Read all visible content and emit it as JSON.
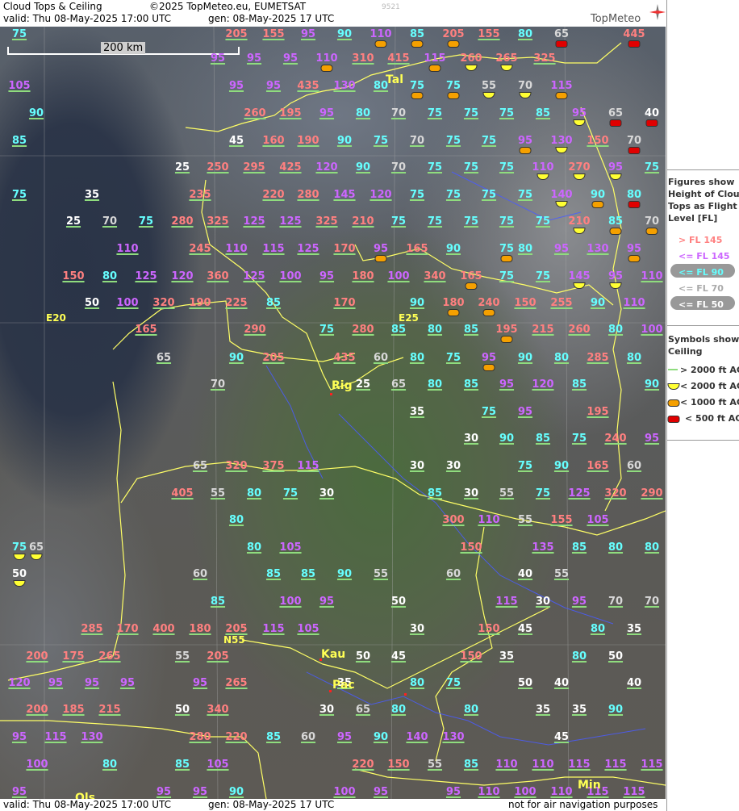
{
  "header": {
    "title": "Cloud Tops & Ceiling",
    "copyright": "©2025 TopMeteo.eu, EUMETSAT",
    "code": "9521",
    "valid": "valid:  Thu  08-May-2025  17:00 UTC",
    "gen": "gen: 08-May-2025 17 UTC",
    "brand": "TopMeteo"
  },
  "footer": {
    "valid": "valid:  Thu  08-May-2025  17:00 UTC",
    "gen": "gen: 08-May-2025 17 UTC",
    "note": "not for air navigation purposes"
  },
  "scale": {
    "label": "200 km"
  },
  "colors": {
    "red": "#ff8080",
    "magenta": "#cc66ff",
    "cyan": "#66ffff",
    "white": "#ffffff",
    "gray": "#d8d8d8",
    "yellow": "#ffff55"
  },
  "legend": {
    "tops_title": [
      "Figures show",
      "Height of Cloud",
      "Tops as Flight",
      "Level  [FL]"
    ],
    "tops_items": [
      {
        "label": "> FL 145",
        "color": "#ff8080"
      },
      {
        "label": "<= FL 145",
        "color": "#cc66ff"
      },
      {
        "label": "<= FL 90",
        "color": "#66ffff"
      },
      {
        "label": "<= FL 70",
        "color": "#aaaaaa"
      },
      {
        "label": "<= FL 50",
        "color": "#ffffff"
      }
    ],
    "ceiling_title": [
      "Symbols show",
      "Ceiling"
    ],
    "ceiling_items": [
      {
        "label": "> 2000 ft AGL",
        "sym": "line"
      },
      {
        "label": "< 2000 ft AGL",
        "sym": "y"
      },
      {
        "label": "< 1000 ft AGL",
        "sym": "o"
      },
      {
        "label": "< 500 ft AGL",
        "sym": "r"
      }
    ]
  },
  "cities": [
    {
      "name": "Tal"
    },
    {
      "name": "Rig"
    },
    {
      "name": "Kau"
    },
    {
      "name": "Pac"
    },
    {
      "name": "Min"
    },
    {
      "name": "Ols"
    }
  ],
  "grid_labels": [
    {
      "name": "E20"
    },
    {
      "name": "E25"
    },
    {
      "name": "N55"
    }
  ],
  "tops": [
    [
      "75",
      "205",
      "155",
      "95",
      "90",
      "110",
      "85",
      "205",
      "155",
      "80",
      "65",
      "445"
    ],
    [
      "95",
      "95",
      "95",
      "110",
      "310",
      "415",
      "115",
      "260",
      "265",
      "325"
    ],
    [
      "105",
      "95",
      "95",
      "435",
      "130",
      "80",
      "75",
      "75",
      "55",
      "70",
      "115"
    ],
    [
      "90",
      "260",
      "195",
      "95",
      "80",
      "70",
      "75",
      "75",
      "75",
      "85",
      "95",
      "65",
      "40"
    ],
    [
      "85",
      "45",
      "160",
      "190",
      "90",
      "75",
      "70",
      "75",
      "75",
      "95",
      "130",
      "150",
      "70"
    ],
    [
      "25",
      "250",
      "295",
      "425",
      "120",
      "90",
      "70",
      "75",
      "75",
      "75",
      "110",
      "270",
      "95",
      "75"
    ],
    [
      "75",
      "35",
      "235",
      "220",
      "280",
      "145",
      "120",
      "75",
      "75",
      "75",
      "75",
      "140",
      "90",
      "80"
    ],
    [
      "25",
      "70",
      "75",
      "280",
      "325",
      "125",
      "125",
      "325",
      "210",
      "75",
      "75",
      "75",
      "75",
      "75",
      "210",
      "85",
      "70"
    ],
    [
      "110",
      "245",
      "110",
      "115",
      "125",
      "170",
      "95",
      "165",
      "90",
      "75",
      "80",
      "95",
      "130",
      "95"
    ],
    [
      "150",
      "80",
      "125",
      "120",
      "360",
      "125",
      "100",
      "95",
      "180",
      "100",
      "340",
      "165",
      "75",
      "75",
      "145",
      "95",
      "110"
    ],
    [
      "50",
      "100",
      "320",
      "190",
      "225",
      "85",
      "170",
      "90",
      "180",
      "240",
      "150",
      "255",
      "90",
      "110"
    ],
    [
      "165",
      "290",
      "75",
      "280",
      "85",
      "80",
      "85",
      "195",
      "215",
      "260",
      "80",
      "100"
    ],
    [
      "65",
      "90",
      "205",
      "435",
      "60",
      "80",
      "75",
      "95",
      "90",
      "80",
      "285",
      "80"
    ],
    [
      "70",
      "25",
      "65",
      "80",
      "85",
      "95",
      "120",
      "85",
      "90"
    ],
    [
      "35",
      "75",
      "95",
      "195"
    ],
    [
      "30",
      "90",
      "85",
      "75",
      "240",
      "95"
    ],
    [
      "65",
      "320",
      "375",
      "115",
      "30",
      "30",
      "75",
      "90",
      "165",
      "60"
    ],
    [
      "405",
      "55",
      "80",
      "75",
      "30",
      "85",
      "30",
      "55",
      "75",
      "125",
      "320",
      "290"
    ],
    [
      "80",
      "300",
      "110",
      "55",
      "155",
      "105"
    ],
    [
      "75",
      "80",
      "105",
      "150",
      "135",
      "85",
      "80",
      "80"
    ],
    [
      "65"
    ],
    [
      "50",
      "60",
      "85",
      "85",
      "90",
      "55",
      "60",
      "40",
      "55"
    ],
    [
      "85",
      "100",
      "95",
      "50",
      "115",
      "30",
      "95",
      "70",
      "70"
    ],
    [
      "285",
      "170",
      "400",
      "180",
      "205",
      "115",
      "105",
      "30",
      "150",
      "45",
      "80",
      "35"
    ],
    [
      "200",
      "175",
      "265",
      "55",
      "205",
      "50",
      "45",
      "150",
      "35",
      "80",
      "50"
    ],
    [
      "120",
      "95",
      "95",
      "95",
      "95",
      "265",
      "35",
      "80",
      "75",
      "50",
      "40",
      "40"
    ],
    [
      "200",
      "185",
      "215",
      "50",
      "340",
      "30",
      "65",
      "80",
      "80",
      "35",
      "35",
      "90"
    ],
    [
      "95",
      "115",
      "130",
      "280",
      "220",
      "85",
      "60",
      "95",
      "90",
      "140",
      "130",
      "45"
    ],
    [
      "100",
      "80",
      "85",
      "105",
      "220",
      "150",
      "55",
      "85",
      "110",
      "110",
      "115",
      "115",
      "115"
    ],
    [
      "95",
      "95",
      "95",
      "90",
      "100",
      "95",
      "95",
      "110",
      "100",
      "110",
      "115",
      "115"
    ]
  ]
}
